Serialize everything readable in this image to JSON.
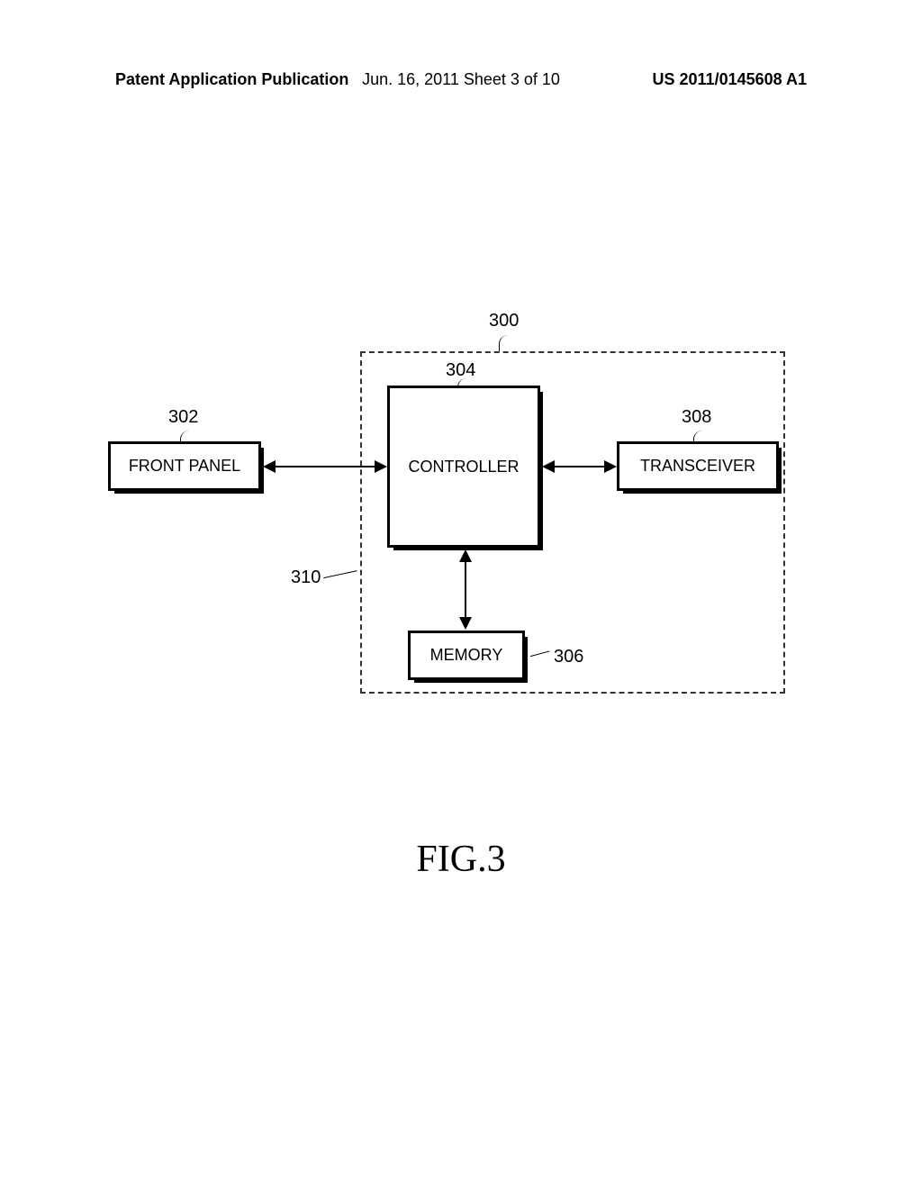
{
  "header": {
    "left": "Patent Application Publication",
    "center": "Jun. 16, 2011  Sheet 3 of 10",
    "right": "US 2011/0145608 A1"
  },
  "blocks": {
    "front_panel": "FRONT PANEL",
    "controller": "CONTROLLER",
    "transceiver": "TRANSCEIVER",
    "memory": "MEMORY"
  },
  "labels": {
    "n300": "300",
    "n302": "302",
    "n304": "304",
    "n306": "306",
    "n308": "308",
    "n310": "310"
  },
  "figure": "FIG.3"
}
